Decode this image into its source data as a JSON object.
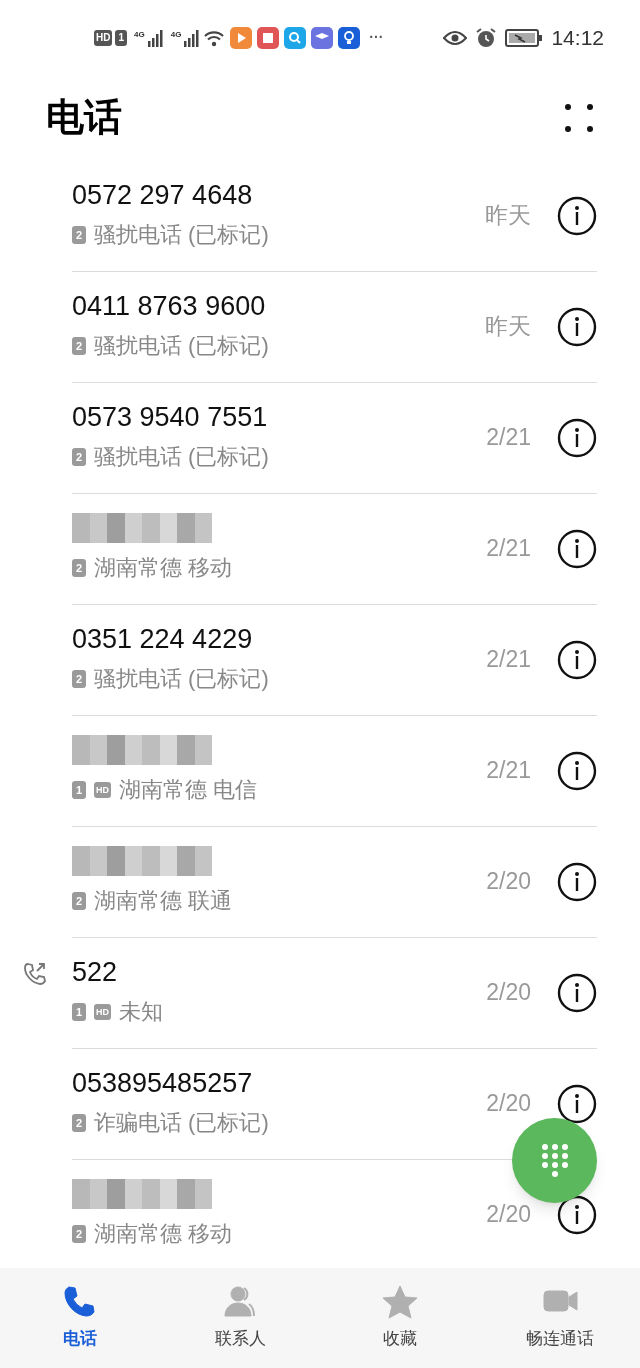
{
  "status_bar": {
    "hd": "HD",
    "sim": "1",
    "net1": "4G",
    "net2": "4G",
    "more": "···",
    "time": "14:12"
  },
  "header": {
    "title": "电话"
  },
  "calls": [
    {
      "name": "0572 297 4648",
      "redacted": false,
      "outgoing": false,
      "sim": "2",
      "hd": false,
      "location": "骚扰电话 (已标记)",
      "date": "昨天"
    },
    {
      "name": "0411 8763 9600",
      "redacted": false,
      "outgoing": false,
      "sim": "2",
      "hd": false,
      "location": "骚扰电话 (已标记)",
      "date": "昨天"
    },
    {
      "name": "0573 9540 7551",
      "redacted": false,
      "outgoing": false,
      "sim": "2",
      "hd": false,
      "location": "骚扰电话 (已标记)",
      "date": "2/21"
    },
    {
      "redacted": true,
      "outgoing": false,
      "sim": "2",
      "hd": false,
      "location": "湖南常德 移动",
      "date": "2/21"
    },
    {
      "name": "0351 224 4229",
      "redacted": false,
      "outgoing": false,
      "sim": "2",
      "hd": false,
      "location": "骚扰电话 (已标记)",
      "date": "2/21"
    },
    {
      "redacted": true,
      "outgoing": false,
      "sim": "1",
      "hd": true,
      "hd_label": "HD",
      "location": "湖南常德 电信",
      "date": "2/21"
    },
    {
      "redacted": true,
      "outgoing": false,
      "sim": "2",
      "hd": false,
      "location": "湖南常德 联通",
      "date": "2/20"
    },
    {
      "name": "522",
      "redacted": false,
      "outgoing": true,
      "sim": "1",
      "hd": true,
      "hd_label": "HD",
      "location": "未知",
      "date": "2/20"
    },
    {
      "name": "053895485257",
      "redacted": false,
      "outgoing": false,
      "sim": "2",
      "hd": false,
      "location": "诈骗电话 (已标记)",
      "date": "2/20"
    },
    {
      "redacted": true,
      "outgoing": false,
      "sim": "2",
      "hd": false,
      "location": "湖南常德 移动",
      "date": "2/20"
    }
  ],
  "tabs": [
    {
      "label": "电话",
      "kind": "phone",
      "selected": true
    },
    {
      "label": "联系人",
      "kind": "contacts",
      "selected": false
    },
    {
      "label": "收藏",
      "kind": "star",
      "selected": false
    },
    {
      "label": "畅连通话",
      "kind": "video",
      "selected": false
    }
  ]
}
